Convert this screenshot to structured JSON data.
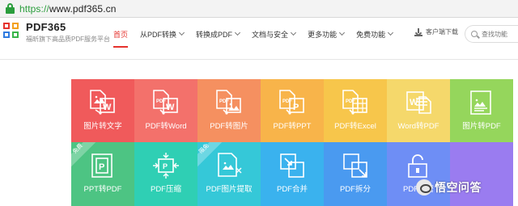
{
  "address_bar": {
    "scheme": "https://",
    "host": "www.pdf365.cn"
  },
  "brand": {
    "name": "PDF365",
    "slogan": "福昕旗下高品质PDF服务平台"
  },
  "nav": [
    {
      "label": "首页",
      "dropdown": false,
      "active": true
    },
    {
      "label": "从PDF转换",
      "dropdown": true,
      "active": false
    },
    {
      "label": "转换成PDF",
      "dropdown": true,
      "active": false
    },
    {
      "label": "文档与安全",
      "dropdown": true,
      "active": false
    },
    {
      "label": "更多功能",
      "dropdown": true,
      "active": false
    },
    {
      "label": "免费功能",
      "dropdown": true,
      "active": false
    }
  ],
  "download": {
    "label": "客户端下载"
  },
  "search": {
    "placeholder": "查找功能"
  },
  "tiles": [
    {
      "label": "图片转文字",
      "color": "#f05a5b",
      "icon": "image-to-word-icon",
      "badge": ""
    },
    {
      "label": "PDF转Word",
      "color": "#f3716b",
      "icon": "pdf-to-word-icon",
      "badge": ""
    },
    {
      "label": "PDF转图片",
      "color": "#f59060",
      "icon": "pdf-to-image-icon",
      "badge": ""
    },
    {
      "label": "PDF转PPT",
      "color": "#f8b44a",
      "icon": "pdf-to-ppt-icon",
      "badge": ""
    },
    {
      "label": "PDF转Excel",
      "color": "#f7c64b",
      "icon": "pdf-to-excel-icon",
      "badge": ""
    },
    {
      "label": "Word转PDF",
      "color": "#f5d86b",
      "icon": "word-to-pdf-icon",
      "badge": ""
    },
    {
      "label": "图片转PDF",
      "color": "#95d65c",
      "icon": "image-to-pdf-icon",
      "badge": ""
    },
    {
      "label": "PPT转PDF",
      "color": "#4dc483",
      "icon": "ppt-to-pdf-icon",
      "badge": "免费"
    },
    {
      "label": "PDF压缩",
      "color": "#2fcfb4",
      "icon": "pdf-compress-icon",
      "badge": ""
    },
    {
      "label": "PDF图片提取",
      "color": "#35c8d8",
      "icon": "pdf-image-extract-icon",
      "badge": "限免"
    },
    {
      "label": "PDF合并",
      "color": "#3ab2ee",
      "icon": "pdf-merge-icon",
      "badge": ""
    },
    {
      "label": "PDF拆分",
      "color": "#4a9af0",
      "icon": "pdf-split-icon",
      "badge": ""
    },
    {
      "label": "PDF解密",
      "color": "#6e8ef5",
      "icon": "pdf-unlock-icon",
      "badge": ""
    },
    {
      "label": "",
      "color": "#9a7cf0",
      "icon": "",
      "badge": ""
    }
  ],
  "watermark": {
    "text": "悟空问答"
  }
}
